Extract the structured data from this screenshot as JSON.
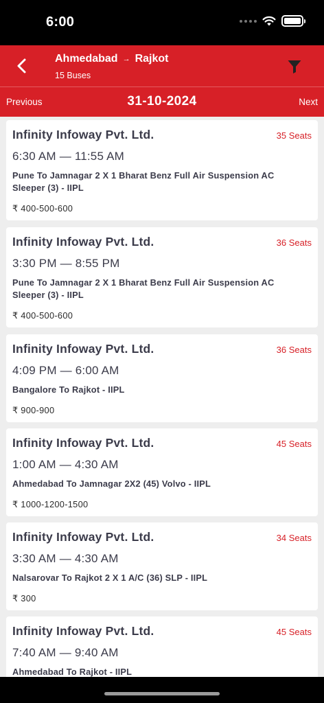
{
  "status_bar": {
    "time": "6:00"
  },
  "header": {
    "from": "Ahmedabad",
    "to": "Rajkot",
    "arrow": "→",
    "bus_count": "15 Buses",
    "back_icon": "chevron-left-icon",
    "filter_icon": "funnel-icon"
  },
  "date_bar": {
    "previous_label": "Previous",
    "date": "31-10-2024",
    "next_label": "Next"
  },
  "colors": {
    "accent": "#d72027",
    "text": "#3b3b4a",
    "background": "#eeeeee"
  },
  "buses": [
    {
      "operator": "Infinity Infoway Pvt. Ltd.",
      "seats": "35 Seats",
      "times": "6:30 AM — 11:55 AM",
      "name": "Pune To Jamnagar 2 X 1 Bharat Benz Full Air Suspension AC Sleeper (3) - IIPL",
      "fare": "₹ 400-500-600"
    },
    {
      "operator": "Infinity Infoway Pvt. Ltd.",
      "seats": "36 Seats",
      "times": "3:30 PM — 8:55 PM",
      "name": "Pune To Jamnagar 2 X 1 Bharat Benz Full Air Suspension AC Sleeper (3) - IIPL",
      "fare": "₹ 400-500-600"
    },
    {
      "operator": "Infinity Infoway Pvt. Ltd.",
      "seats": "36 Seats",
      "times": "4:09 PM — 6:00 AM",
      "name": "Bangalore To Rajkot - IIPL",
      "fare": "₹ 900-900"
    },
    {
      "operator": "Infinity Infoway Pvt. Ltd.",
      "seats": "45 Seats",
      "times": "1:00 AM — 4:30 AM",
      "name": "Ahmedabad To Jamnagar 2X2 (45) Volvo - IIPL",
      "fare": "₹ 1000-1200-1500"
    },
    {
      "operator": "Infinity Infoway Pvt. Ltd.",
      "seats": "34 Seats",
      "times": "3:30 AM — 4:30 AM",
      "name": "Nalsarovar To Rajkot 2 X 1 A/C (36) SLP  - IIPL",
      "fare": "₹ 300"
    },
    {
      "operator": "Infinity Infoway Pvt. Ltd.",
      "seats": "45 Seats",
      "times": "7:40 AM — 9:40 AM",
      "name": "Ahmedabad To Rajkot - IIPL",
      "fare": ""
    }
  ]
}
